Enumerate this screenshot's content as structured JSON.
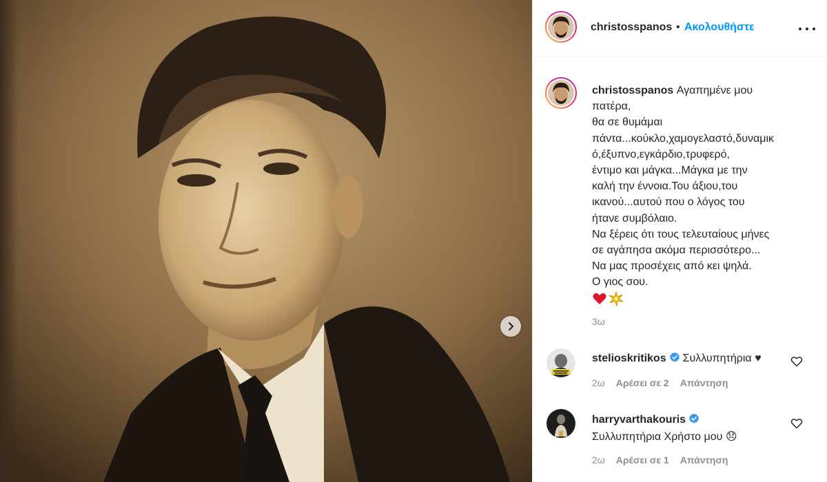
{
  "post": {
    "username": "christosspanos",
    "follow_label": "Ακολουθήστε",
    "dot": "•"
  },
  "caption": {
    "username": "christosspanos",
    "lines": [
      "Αγαπημένε μου",
      "πατέρα,",
      "θα σε θυμάμαι",
      "πάντα...κούκλο,χαμογελαστό,δυναμικ",
      "ό,έξυπνο,εγκάρδιο,τρυφερό,",
      "έντιμο και μάγκα...Μάγκα με την",
      "καλή την έννοια.Του άξιου,του",
      "ικανού...αυτού που ο λόγος του",
      "ήτανε συμβόλαιο.",
      "Να ξέρεις ότι τους τελευταίους μήνες",
      "σε αγάπησα ακόμα περισσότερο...",
      "Να μας προσέχεις από κει ψηλά.",
      "Ο γιος σου."
    ],
    "emojis": [
      "red-heart",
      "sparkle-burst"
    ],
    "time": "3ω"
  },
  "comments": [
    {
      "username": "stelioskritikos",
      "verified": true,
      "text": "Συλλυπητήρια ♥",
      "time": "2ω",
      "likes_label": "Αρέσει σε 2",
      "reply_label": "Απάντηση"
    },
    {
      "username": "harryvarthakouris",
      "verified": true,
      "text": "Συλλυπητήρια Χρήστο μου 😞",
      "time": "2ω",
      "likes_label": "Αρέσει σε 1",
      "reply_label": "Απάντηση"
    }
  ],
  "colors": {
    "link_blue": "#0095f6",
    "verified_blue": "#3897f0",
    "muted": "#8e8e8e",
    "sepia_photo": "#8a6b45"
  }
}
